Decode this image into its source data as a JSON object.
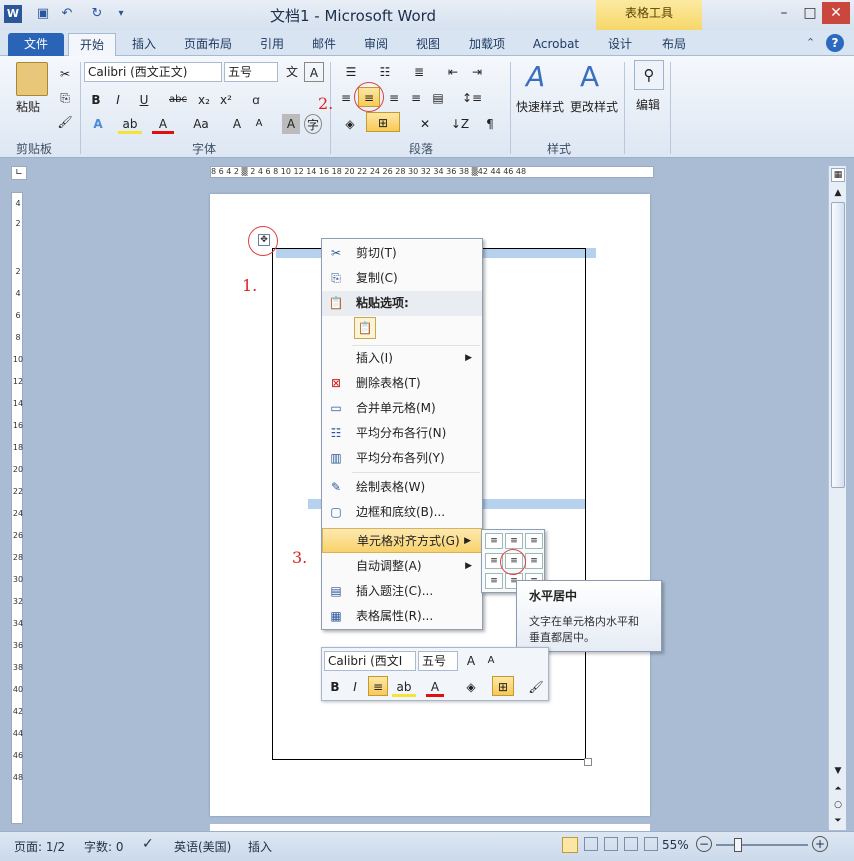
{
  "window": {
    "title": "文档1 - Microsoft Word",
    "context_tools": "表格工具"
  },
  "tabs": [
    "文件",
    "开始",
    "插入",
    "页面布局",
    "引用",
    "邮件",
    "审阅",
    "视图",
    "加载项",
    "Acrobat",
    "设计",
    "布局"
  ],
  "ribbon": {
    "clipboard": {
      "paste_label": "粘贴",
      "group": "剪贴板"
    },
    "font": {
      "font_name": "Calibri (西文正文)",
      "font_size": "五号",
      "group": "字体"
    },
    "paragraph": {
      "group": "段落"
    },
    "styles": {
      "quick_styles": "快速样式",
      "change_styles": "更改样式",
      "group": "样式"
    },
    "editing": {
      "label": "编辑"
    }
  },
  "ruler_top_text": "8  6  4  2  ▒  2  4  6  8  10 12 14 16 18 20 22 24 26 28 30 32 34 36 38 ▒42 44 46 48",
  "ruler_left_nums": [
    "4",
    "2",
    "2",
    "4",
    "6",
    "8",
    "10",
    "12",
    "14",
    "16",
    "18",
    "20",
    "22",
    "24",
    "26",
    "28",
    "30",
    "32",
    "34",
    "36",
    "38",
    "40",
    "42",
    "44",
    "46",
    "48"
  ],
  "annotations": {
    "step1": "1.",
    "step2": "2.",
    "step3": "3."
  },
  "context_menu": {
    "cut": "剪切(T)",
    "copy": "复制(C)",
    "paste_options": "粘贴选项:",
    "insert": "插入(I)",
    "delete_table": "删除表格(T)",
    "merge_cells": "合并单元格(M)",
    "distribute_rows": "平均分布各行(N)",
    "distribute_cols": "平均分布各列(Y)",
    "draw_table": "绘制表格(W)",
    "borders": "边框和底纹(B)...",
    "cell_align": "单元格对齐方式(G)",
    "autofit": "自动调整(A)",
    "insert_caption": "插入题注(C)...",
    "table_props": "表格属性(R)..."
  },
  "tooltip": {
    "title": "水平居中",
    "body": "文字在单元格内水平和垂直都居中。"
  },
  "mini_toolbar": {
    "font_name": "Calibri (西文I",
    "font_size": "五号"
  },
  "status": {
    "page": "页面: 1/2",
    "words": "字数: 0",
    "language": "英语(美国)",
    "mode": "插入",
    "zoom": "55%"
  }
}
